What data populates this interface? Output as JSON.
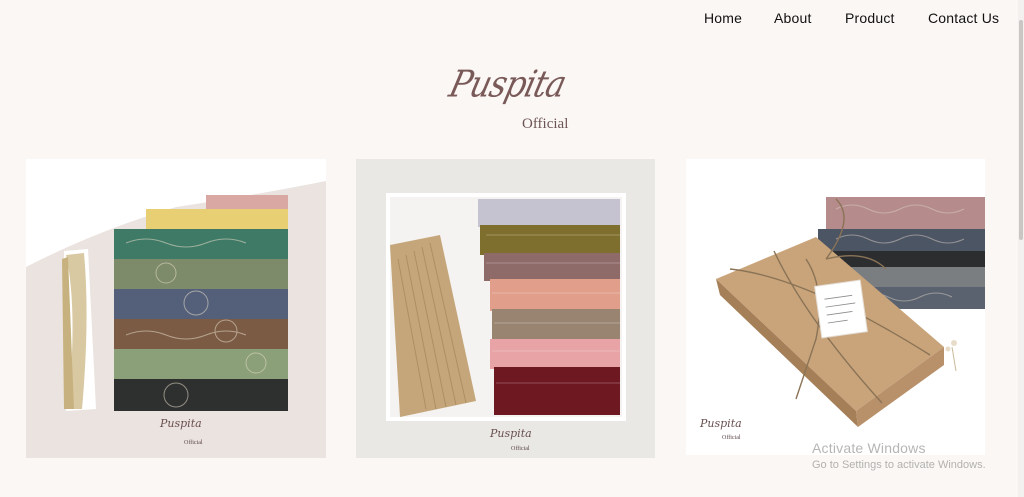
{
  "nav": {
    "items": [
      {
        "label": "Home"
      },
      {
        "label": "About"
      },
      {
        "label": "Product"
      },
      {
        "label": "Contact Us"
      }
    ]
  },
  "logo": {
    "script": "Puspita",
    "sub": "Official"
  },
  "products": [
    {
      "name": "hijab-stack-floral",
      "watermark": "Puspita",
      "watermark_sub": "Official"
    },
    {
      "name": "hijab-stack-pleated",
      "watermark": "Puspita",
      "watermark_sub": "Official"
    },
    {
      "name": "gift-box-hijab",
      "watermark": "Puspita",
      "watermark_sub": "Official"
    }
  ],
  "gift_tag_icon": "gift-tag-icon",
  "os_notice": {
    "title": "Activate Windows",
    "subtitle": "Go to Settings to activate Windows."
  },
  "colors": {
    "background": "#faf7f4",
    "brand_text": "#7a5a58"
  }
}
